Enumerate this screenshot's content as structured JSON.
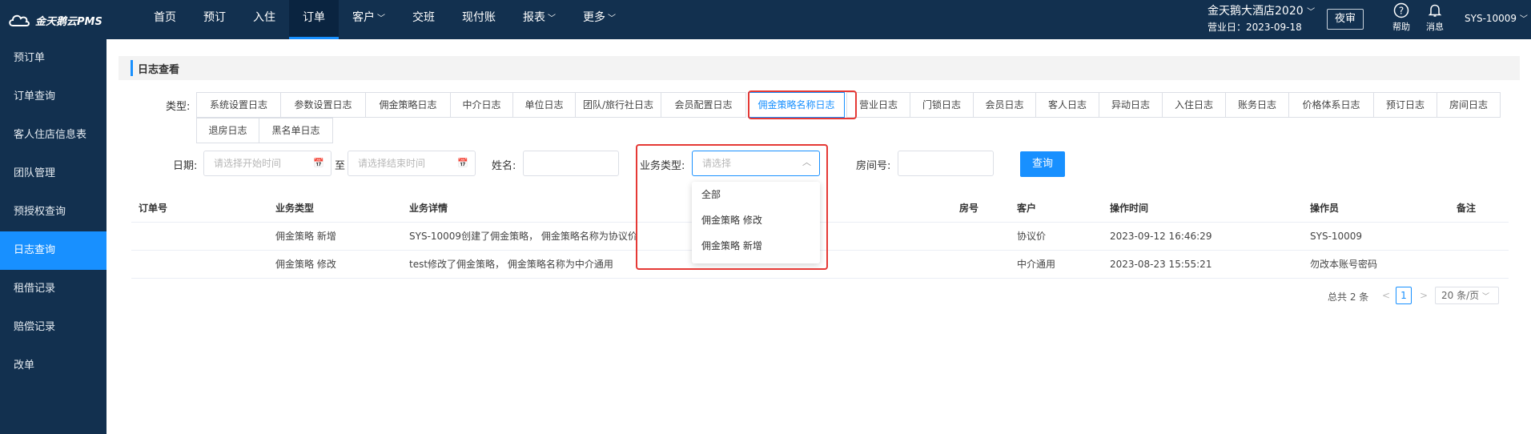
{
  "app": {
    "logo_text": "金天鹅云PMS"
  },
  "topnav": [
    {
      "label": "首页",
      "caret": false
    },
    {
      "label": "预订",
      "caret": false
    },
    {
      "label": "入住",
      "caret": false
    },
    {
      "label": "订单",
      "caret": false,
      "active": true
    },
    {
      "label": "客户",
      "caret": true
    },
    {
      "label": "交班",
      "caret": false
    },
    {
      "label": "现付账",
      "caret": false
    },
    {
      "label": "报表",
      "caret": true
    },
    {
      "label": "更多",
      "caret": true
    }
  ],
  "header": {
    "hotel_name": "金天鹅大酒店2020",
    "business_date": "营业日：2023-09-18",
    "night_audit": "夜审",
    "help": "帮助",
    "messages": "消息",
    "user": "SYS-10009"
  },
  "sidebar": [
    {
      "label": "预订单"
    },
    {
      "label": "订单查询"
    },
    {
      "label": "客人住店信息表"
    },
    {
      "label": "团队管理"
    },
    {
      "label": "预授权查询"
    },
    {
      "label": "日志查询",
      "active": true
    },
    {
      "label": "租借记录"
    },
    {
      "label": "赔偿记录"
    },
    {
      "label": "改单"
    }
  ],
  "page": {
    "title": "日志查看"
  },
  "filters": {
    "type_label": "类型:",
    "log_types": [
      "系统设置日志",
      "参数设置日志",
      "佣金策略日志",
      "中介日志",
      "单位日志",
      "团队/旅行社日志",
      "会员配置日志",
      "佣金策略名称日志",
      "营业日志",
      "门锁日志",
      "会员日志",
      "客人日志",
      "异动日志",
      "入住日志",
      "账务日志",
      "价格体系日志",
      "预订日志",
      "房间日志",
      "退房日志",
      "黑名单日志"
    ],
    "active_type": "佣金策略名称日志",
    "date_label": "日期:",
    "start_placeholder": "请选择开始时间",
    "to": "至",
    "end_placeholder": "请选择结束时间",
    "name_label": "姓名:",
    "biz_type_label": "业务类型:",
    "biz_type_placeholder": "请选择",
    "room_label": "房间号:",
    "query_button": "查询"
  },
  "dropdown_options": [
    "全部",
    "佣金策略 修改",
    "佣金策略 新增"
  ],
  "table": {
    "columns": [
      "订单号",
      "业务类型",
      "业务详情",
      "房号",
      "客户",
      "操作时间",
      "操作员",
      "备注"
    ],
    "rows": [
      {
        "order_no": "",
        "biz_type": "佣金策略 新增",
        "detail": "SYS-10009创建了佣金策略， 佣金策略名称为协议价",
        "room": "",
        "customer": "协议价",
        "time": "2023-09-12 16:46:29",
        "operator": "SYS-10009",
        "remark": ""
      },
      {
        "order_no": "",
        "biz_type": "佣金策略 修改",
        "detail": "test修改了佣金策略， 佣金策略名称为中介通用",
        "room": "",
        "customer": "中介通用",
        "time": "2023-08-23 15:55:21",
        "operator": "勿改本账号密码",
        "remark": ""
      }
    ]
  },
  "pagination": {
    "total": "总共 2 条",
    "prev": "<",
    "current": "1",
    "next": ">",
    "page_size": "20 条/页"
  },
  "colors": {
    "navy": "#12304f",
    "accent": "#1890ff",
    "highlight": "#e53935"
  }
}
